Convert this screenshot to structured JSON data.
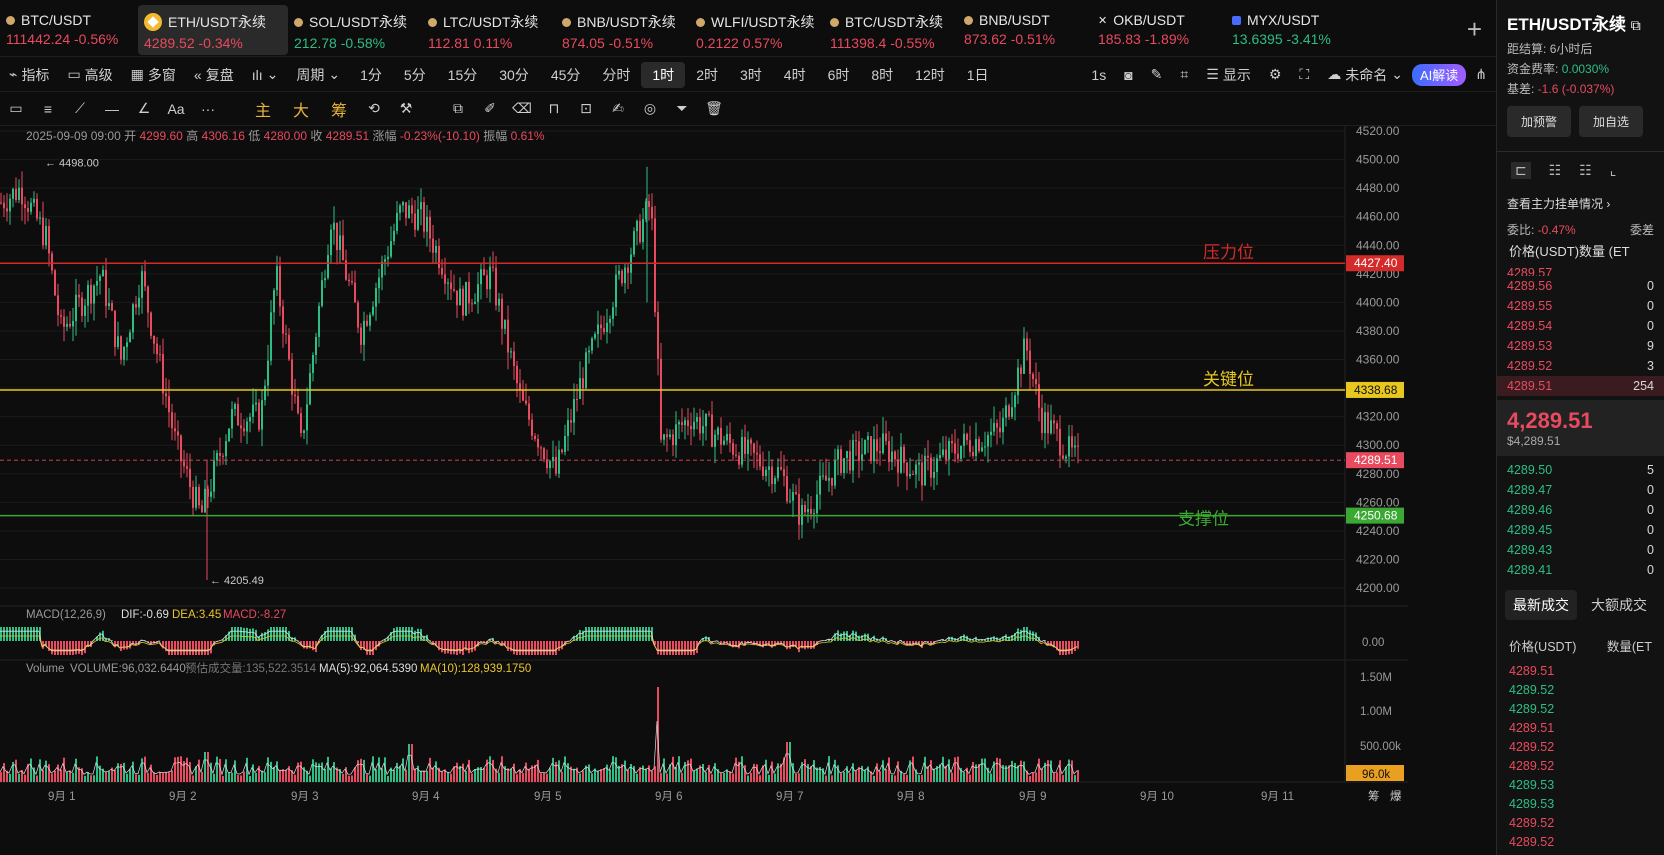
{
  "tickers": [
    {
      "symbol": "BTC/USDT",
      "price": "111442.24",
      "change": "-0.56%",
      "dir": "dn",
      "icon": "dot-icon"
    },
    {
      "symbol": "ETH/USDT永续",
      "price": "4289.52",
      "change": "-0.34%",
      "dir": "dn",
      "icon": "binance-icon",
      "active": true
    },
    {
      "symbol": "SOL/USDT永续",
      "price": "212.78",
      "change": "-0.58%",
      "dir": "up",
      "icon": "dot-icon"
    },
    {
      "symbol": "LTC/USDT永续",
      "price": "112.81",
      "change": "0.11%",
      "dir": "dn",
      "icon": "dot-icon"
    },
    {
      "symbol": "BNB/USDT永续",
      "price": "874.05",
      "change": "-0.51%",
      "dir": "dn",
      "icon": "dot-icon"
    },
    {
      "symbol": "WLFI/USDT永续",
      "price": "0.2122",
      "change": "0.57%",
      "dir": "dn",
      "icon": "dot-icon"
    },
    {
      "symbol": "BTC/USDT永续",
      "price": "111398.4",
      "change": "-0.55%",
      "dir": "dn",
      "icon": "dot-icon"
    },
    {
      "symbol": "BNB/USDT",
      "price": "873.62",
      "change": "-0.51%",
      "dir": "dn",
      "icon": "dot-icon"
    },
    {
      "symbol": "OKB/USDT",
      "price": "185.83",
      "change": "-1.89%",
      "dir": "dn",
      "icon": "x-icon"
    },
    {
      "symbol": "MYX/USDT",
      "price": "13.6395",
      "change": "-3.41%",
      "dir": "up",
      "icon": "square-icon"
    }
  ],
  "toolbar1": {
    "indicators": "指标",
    "advanced": "高级",
    "multi": "多窗",
    "replay": "复盘",
    "period": "周期",
    "timeframes": [
      "1分",
      "5分",
      "15分",
      "30分",
      "45分",
      "分时",
      "1时",
      "2时",
      "3时",
      "4时",
      "6时",
      "8时",
      "12时",
      "1日"
    ],
    "selected_tf": "1时",
    "refresh": "1s",
    "display": "显示",
    "cloud": "未命名",
    "ai": "AI解读"
  },
  "toolbar2": {
    "main": "主",
    "big": "大",
    "chip": "筹"
  },
  "ohlc": {
    "datetime": "2025-09-09 09:00",
    "open_label": "开",
    "open": "4299.60",
    "high_label": "高",
    "high": "4306.16",
    "low_label": "低",
    "low": "4280.00",
    "close_label": "收",
    "close": "4289.51",
    "chg_label": "涨幅",
    "chg": "-0.23%(-10.10)",
    "amp_label": "振幅",
    "amp": "0.61%"
  },
  "chart_data": {
    "type": "candlestick",
    "price_axis": [
      4200,
      4220,
      4240,
      4260,
      4280,
      4300,
      4320,
      4340,
      4360,
      4380,
      4400,
      4420,
      4440,
      4460,
      4480,
      4500,
      4520
    ],
    "ylim": [
      4190,
      4525
    ],
    "x_labels": [
      "9月 1",
      "9月 2",
      "9月 3",
      "9月 4",
      "9月 5",
      "9月 6",
      "9月 7",
      "9月 8",
      "9月 9",
      "9月 10",
      "9月 11"
    ],
    "high_marker": "4498.00",
    "low_marker": "4205.49",
    "lines": [
      {
        "label": "压力位",
        "value": 4427.4,
        "tag": "4427.40",
        "color": "#d42a2a"
      },
      {
        "label": "关键位",
        "value": 4338.68,
        "tag": "4338.68",
        "color": "#e8c81e"
      },
      {
        "label": "支撑位",
        "value": 4250.68,
        "tag": "4250.68",
        "color": "#3aa832"
      }
    ],
    "last_price": {
      "value": 4289.51,
      "tag": "4289.51"
    },
    "macd": {
      "label": "MACD(12,26,9)",
      "dif": "DIF:-0.69",
      "dea": "DEA:3.45",
      "macd": "MACD:-8.27",
      "zero": "0.00"
    },
    "volume": {
      "label": "Volume",
      "vol": "VOLUME:96,032.6440",
      "est": "预估成交量:135,522.3514",
      "ma5": "MA(5):92,064.5390",
      "ma10": "MA(10):128,939.1750",
      "axis": [
        "1.50M",
        "1.00M",
        "500.00k"
      ],
      "tag": "96.0k"
    },
    "bottom_right": [
      "筹",
      "爆"
    ]
  },
  "right": {
    "title": "ETH/USDT永续",
    "settle_label": "距结算:",
    "settle": "6小时后",
    "funding_label": "资金费率:",
    "funding": "0.0030%",
    "basis_label": "基差:",
    "basis": "-1.6 (-0.037%)",
    "btn_alert": "加预警",
    "btn_fav": "加自选",
    "depth_link": "查看主力挂单情况",
    "ratio_label": "委比:",
    "ratio": "-0.47%",
    "ratio2": "委差",
    "col_price": "价格(USDT)",
    "col_qty": "数量 (ET",
    "asks": [
      "4289.57",
      "4289.56",
      "4289.55",
      "4289.54",
      "4289.53",
      "4289.52",
      "4289.51"
    ],
    "ask_qty": [
      "",
      "0",
      "0",
      "0",
      "9",
      "3",
      "254"
    ],
    "last": "4,289.51",
    "last_usd": "$4,289.51",
    "bids": [
      "4289.50",
      "4289.47",
      "4289.46",
      "4289.45",
      "4289.43",
      "4289.41"
    ],
    "bid_qty": [
      "5",
      "0",
      "0",
      "0",
      "0",
      "0"
    ],
    "tab_latest": "最新成交",
    "tab_big": "大额成交",
    "t_col_price": "价格(USDT)",
    "t_col_qty": "数量(ET",
    "trades": [
      {
        "p": "4289.51",
        "d": "dn"
      },
      {
        "p": "4289.52",
        "d": "up"
      },
      {
        "p": "4289.52",
        "d": "up"
      },
      {
        "p": "4289.51",
        "d": "dn"
      },
      {
        "p": "4289.52",
        "d": "dn"
      },
      {
        "p": "4289.52",
        "d": "dn"
      },
      {
        "p": "4289.53",
        "d": "up"
      },
      {
        "p": "4289.53",
        "d": "up"
      },
      {
        "p": "4289.52",
        "d": "dn"
      },
      {
        "p": "4289.52",
        "d": "dn"
      }
    ]
  }
}
